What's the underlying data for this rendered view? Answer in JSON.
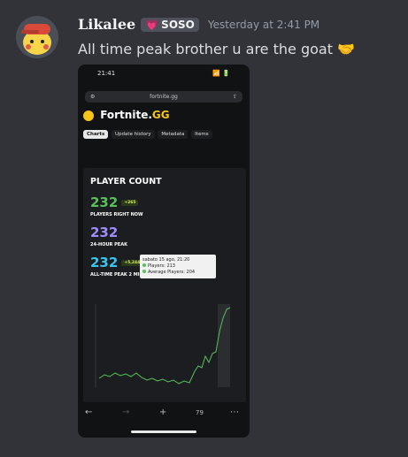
{
  "message": {
    "username": "Likalee",
    "tag_label": "SOSO",
    "timestamp": "Yesterday at 2:41 PM",
    "text": "All time peak brother u are the goat 🤝"
  },
  "attachment": {
    "status_time": "21:41",
    "status_icons": "📶 🔋",
    "url": "fortnite.gg",
    "site_name": "Fortnite.",
    "site_suffix": "GG",
    "tabs": [
      "Charts",
      "Update history",
      "Metadata",
      "Items"
    ],
    "card_title": "PLAYER COUNT",
    "players_now": "232",
    "players_now_label": "PLAYERS RIGHT NOW",
    "badge_now": "+265",
    "peak24": "232",
    "peak24_label": "24-HOUR PEAK",
    "peak_all": "232",
    "peak_all_label": "ALL-TIME PEAK 2 MINUTI FA",
    "badge_peak": "+5,244",
    "tooltip_date": "sabato 15 ago, 21:20",
    "tooltip_players": "Players: 213",
    "tooltip_avg": "Average Players: 204",
    "nav_icons": [
      "←",
      "→",
      "+",
      "79",
      "⋯"
    ]
  },
  "colors": {
    "bg": "#313338",
    "accent_green": "#57c25a",
    "peak_purple": "#a08cff",
    "peak_cyan": "#37c7f0",
    "brand_yellow": "#f5c518"
  }
}
